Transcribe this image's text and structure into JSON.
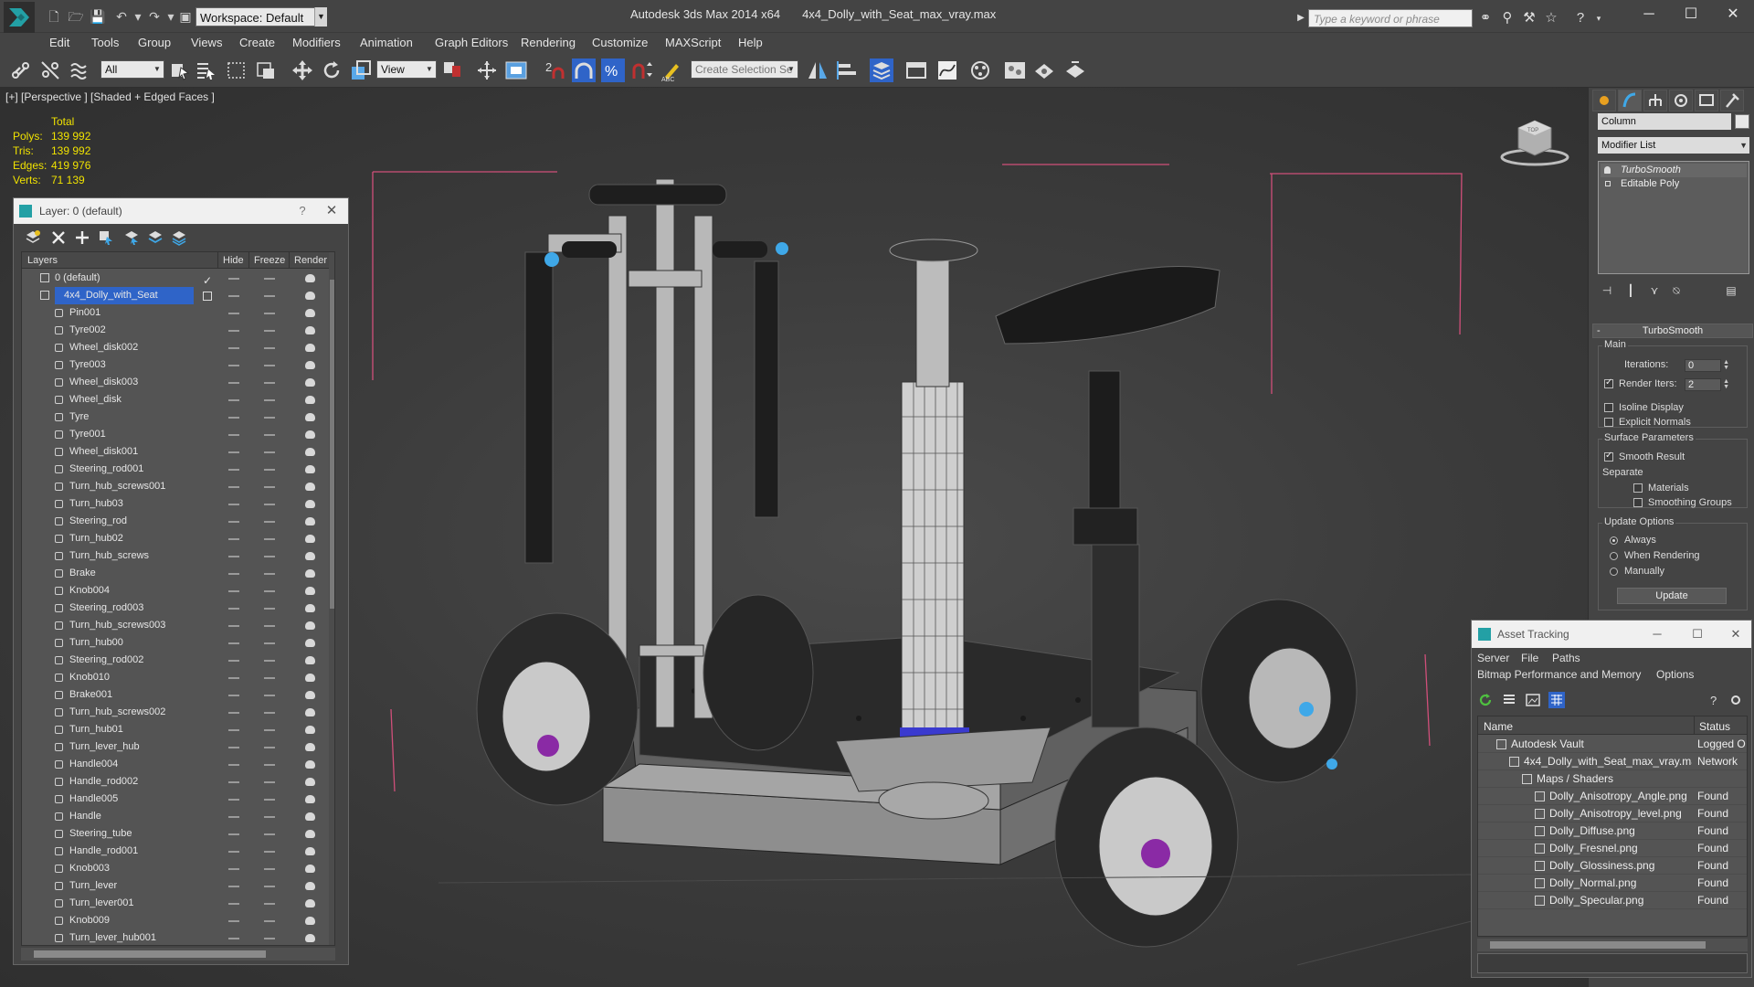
{
  "titlebar": {
    "workspace": "Workspace: Default",
    "app_name": "Autodesk 3ds Max  2014 x64",
    "file_name": "4x4_Dolly_with_Seat_max_vray.max",
    "search_placeholder": "Type a keyword or phrase"
  },
  "menu": [
    "Edit",
    "Tools",
    "Group",
    "Views",
    "Create",
    "Modifiers",
    "Animation",
    "Graph Editors",
    "Rendering",
    "Customize",
    "MAXScript",
    "Help"
  ],
  "toolbar": {
    "filter_value": "All",
    "ref_coord_value": "View",
    "selection_set_placeholder": "Create Selection Se",
    "snap_label": "2"
  },
  "viewport": {
    "label": "[+] [Perspective ] [Shaded + Edged Faces ]",
    "stats": {
      "header": "Total",
      "rows": [
        {
          "label": "Polys:",
          "value": "139 992"
        },
        {
          "label": "Tris:",
          "value": "139 992"
        },
        {
          "label": "Edges:",
          "value": "419 976"
        },
        {
          "label": "Verts:",
          "value": "71 139"
        }
      ]
    },
    "viewcube_label": "TOP"
  },
  "layer_dialog": {
    "title": "Layer: 0 (default)",
    "help": "?",
    "columns": {
      "layers": "Layers",
      "hide": "Hide",
      "freeze": "Freeze",
      "render": "Render"
    },
    "layers": [
      {
        "name": "0 (default)",
        "type": "layer",
        "current": true
      },
      {
        "name": "4x4_Dolly_with_Seat",
        "type": "layer",
        "selected": true
      }
    ],
    "objects": [
      "Pin001",
      "Tyre002",
      "Wheel_disk002",
      "Tyre003",
      "Wheel_disk003",
      "Wheel_disk",
      "Tyre",
      "Tyre001",
      "Wheel_disk001",
      "Steering_rod001",
      "Turn_hub_screws001",
      "Turn_hub03",
      "Steering_rod",
      "Turn_hub02",
      "Turn_hub_screws",
      "Brake",
      "Knob004",
      "Steering_rod003",
      "Turn_hub_screws003",
      "Turn_hub00",
      "Steering_rod002",
      "Knob010",
      "Brake001",
      "Turn_hub_screws002",
      "Turn_hub01",
      "Turn_lever_hub",
      "Handle004",
      "Handle_rod002",
      "Handle005",
      "Handle",
      "Steering_tube",
      "Handle_rod001",
      "Knob003",
      "Turn_lever",
      "Turn_lever001",
      "Knob009",
      "Turn_lever_hub001"
    ]
  },
  "command_panel": {
    "object_name": "Column",
    "modifier_list": "Modifier List",
    "stack": [
      "TurboSmooth",
      "Editable Poly"
    ],
    "rollout": {
      "title": "TurboSmooth",
      "main_group": "Main",
      "iterations_label": "Iterations:",
      "iterations_value": "0",
      "render_iters_label": "Render Iters:",
      "render_iters_value": "2",
      "isoline": "Isoline Display",
      "explicit_normals": "Explicit Normals",
      "surface_group": "Surface Parameters",
      "smooth_result": "Smooth Result",
      "separate": "Separate",
      "materials": "Materials",
      "smoothing_groups": "Smoothing Groups",
      "update_group": "Update Options",
      "always": "Always",
      "when_rendering": "When Rendering",
      "manually": "Manually",
      "update_button": "Update"
    }
  },
  "asset_tracking": {
    "title": "Asset Tracking",
    "menu": [
      "Server",
      "File",
      "Paths",
      "Bitmap Performance and Memory",
      "Options"
    ],
    "columns": {
      "name": "Name",
      "status": "Status"
    },
    "rows": [
      {
        "name": "Autodesk Vault",
        "status": "Logged O",
        "indent": 0
      },
      {
        "name": "4x4_Dolly_with_Seat_max_vray.max",
        "status": "Network",
        "indent": 1
      },
      {
        "name": "Maps / Shaders",
        "status": "",
        "indent": 2
      },
      {
        "name": "Dolly_Anisotropy_Angle.png",
        "status": "Found",
        "indent": 3
      },
      {
        "name": "Dolly_Anisotropy_level.png",
        "status": "Found",
        "indent": 3
      },
      {
        "name": "Dolly_Diffuse.png",
        "status": "Found",
        "indent": 3
      },
      {
        "name": "Dolly_Fresnel.png",
        "status": "Found",
        "indent": 3
      },
      {
        "name": "Dolly_Glossiness.png",
        "status": "Found",
        "indent": 3
      },
      {
        "name": "Dolly_Normal.png",
        "status": "Found",
        "indent": 3
      },
      {
        "name": "Dolly_Specular.png",
        "status": "Found",
        "indent": 3
      }
    ]
  },
  "colors": {
    "ui_bg": "#444444",
    "selection": "#2f64c8",
    "stats_yellow": "#f0e200",
    "bounding_box": "#d04f7a",
    "brand_teal": "#23a0a5"
  }
}
